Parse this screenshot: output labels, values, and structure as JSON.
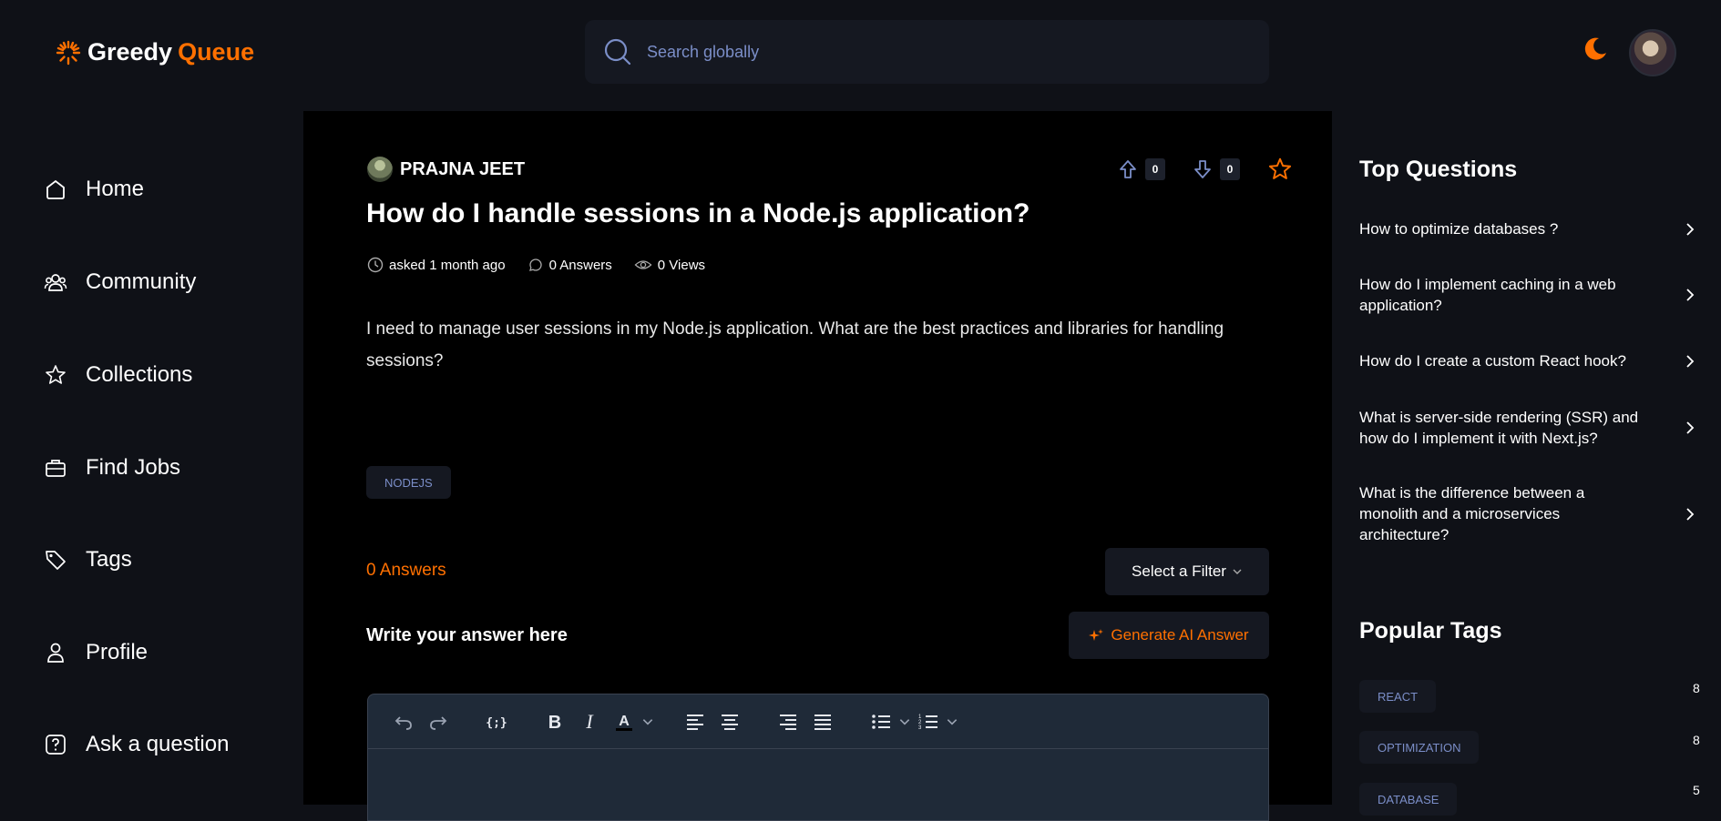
{
  "header": {
    "logo_word1": "Greedy",
    "logo_word2": "Queue",
    "search_placeholder": "Search globally",
    "accent_color": "#ff7000"
  },
  "sidebar": {
    "items": [
      {
        "label": "Home",
        "icon": "home-icon"
      },
      {
        "label": "Community",
        "icon": "users-icon"
      },
      {
        "label": "Collections",
        "icon": "star-icon"
      },
      {
        "label": "Find Jobs",
        "icon": "briefcase-icon"
      },
      {
        "label": "Tags",
        "icon": "tag-icon"
      },
      {
        "label": "Profile",
        "icon": "user-icon"
      },
      {
        "label": "Ask a question",
        "icon": "question-icon"
      }
    ]
  },
  "question": {
    "author": "PRAJNA JEET",
    "upvotes": "0",
    "downvotes": "0",
    "title": "How do I handle sessions in a Node.js application?",
    "asked": "asked 1 month ago",
    "answers": "0 Answers",
    "views": "0 Views",
    "body": " I need to manage user sessions in my Node.js application. What are the best practices and libraries for handling sessions?",
    "tag": "NODEJS"
  },
  "answers_section": {
    "count_label": "0 Answers",
    "filter_label": "Select a Filter",
    "write_label": "Write your answer here",
    "generate_label": "Generate AI Answer"
  },
  "right_sidebar": {
    "top_questions_title": "Top Questions",
    "top_questions": [
      "How to optimize databases ?",
      "How do I implement caching in a web application?",
      "How do I create a custom React hook?",
      "What is server-side rendering (SSR) and how do I implement it with Next.js?",
      "What is the difference between a monolith and a microservices architecture?"
    ],
    "popular_tags_title": "Popular Tags",
    "popular_tags": [
      {
        "name": "REACT",
        "count": "8"
      },
      {
        "name": "OPTIMIZATION",
        "count": "8"
      },
      {
        "name": "DATABASE",
        "count": "5"
      }
    ]
  }
}
